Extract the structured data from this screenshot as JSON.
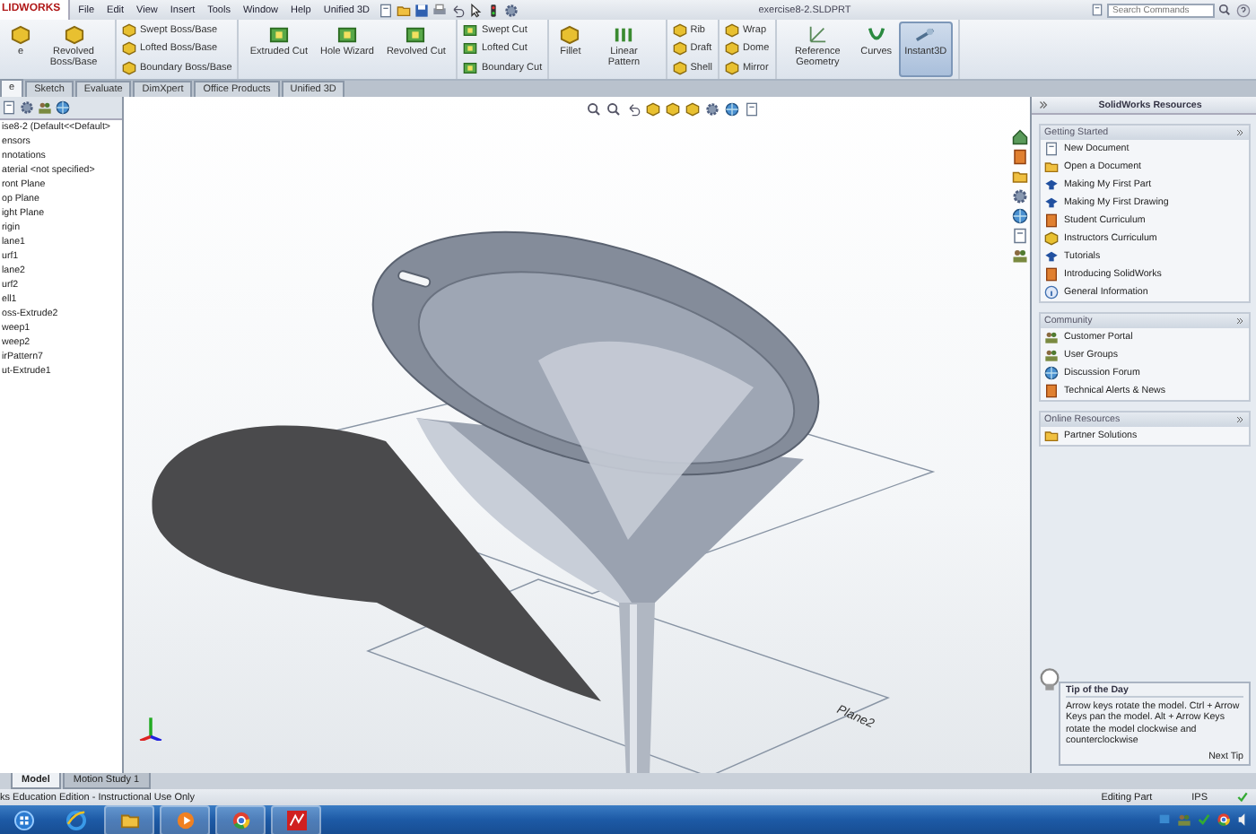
{
  "app": {
    "logo": "LIDWORKS",
    "menus": [
      "File",
      "Edit",
      "View",
      "Insert",
      "Tools",
      "Window",
      "Help",
      "Unified 3D"
    ],
    "title": "exercise8-2.SLDPRT",
    "search": {
      "placeholder": "Search Commands"
    }
  },
  "ribbon": {
    "groups": [
      {
        "kind": "large",
        "items": [
          {
            "label": "e",
            "selected": false
          },
          {
            "label": "Revolved Boss/Base",
            "selected": false
          }
        ]
      },
      {
        "kind": "stack",
        "items": [
          {
            "label": "Swept Boss/Base"
          },
          {
            "label": "Lofted Boss/Base"
          },
          {
            "label": "Boundary Boss/Base"
          }
        ]
      },
      {
        "kind": "large",
        "items": [
          {
            "label": "Extruded Cut",
            "selected": false
          },
          {
            "label": "Hole Wizard",
            "selected": false
          },
          {
            "label": "Revolved Cut",
            "selected": false
          }
        ]
      },
      {
        "kind": "stack",
        "items": [
          {
            "label": "Swept Cut"
          },
          {
            "label": "Lofted Cut"
          },
          {
            "label": "Boundary Cut"
          }
        ]
      },
      {
        "kind": "large",
        "items": [
          {
            "label": "Fillet",
            "selected": false
          },
          {
            "label": "Linear Pattern",
            "selected": false
          }
        ]
      },
      {
        "kind": "stack",
        "items": [
          {
            "label": "Rib"
          },
          {
            "label": "Draft"
          },
          {
            "label": "Shell"
          }
        ]
      },
      {
        "kind": "stack",
        "items": [
          {
            "label": "Wrap"
          },
          {
            "label": "Dome"
          },
          {
            "label": "Mirror"
          }
        ]
      },
      {
        "kind": "large",
        "items": [
          {
            "label": "Reference Geometry",
            "selected": false
          },
          {
            "label": "Curves",
            "selected": false
          },
          {
            "label": "Instant3D",
            "selected": true
          }
        ]
      }
    ],
    "tabs": [
      {
        "label": "e",
        "selected": true
      },
      {
        "label": "Sketch",
        "selected": false
      },
      {
        "label": "Evaluate",
        "selected": false
      },
      {
        "label": "DimXpert",
        "selected": false
      },
      {
        "label": "Office Products",
        "selected": false
      },
      {
        "label": "Unified 3D",
        "selected": false
      }
    ]
  },
  "tree": {
    "items": [
      "ise8-2  (Default<<Default>",
      "ensors",
      "nnotations",
      "aterial <not specified>",
      "ront Plane",
      "op Plane",
      "ight Plane",
      "rigin",
      "lane1",
      "urf1",
      "lane2",
      "urf2",
      "ell1",
      "oss-Extrude2",
      "weep1",
      "weep2",
      "irPattern7",
      "ut-Extrude1"
    ]
  },
  "viewport": {
    "plane_label": "Plane2"
  },
  "task_pane": {
    "title": "SolidWorks Resources",
    "sections": [
      {
        "title": "Getting Started",
        "items": [
          "New Document",
          "Open a Document",
          "Making My First Part",
          "Making My First Drawing",
          "Student Curriculum",
          "Instructors Curriculum",
          "Tutorials",
          "Introducing SolidWorks",
          "General Information"
        ]
      },
      {
        "title": "Community",
        "items": [
          "Customer Portal",
          "User Groups",
          "Discussion Forum",
          "Technical Alerts & News"
        ]
      },
      {
        "title": "Online Resources",
        "items": [
          "Partner Solutions"
        ]
      }
    ],
    "tip": {
      "title": "Tip of the Day",
      "text": "Arrow keys rotate the model. Ctrl + Arrow Keys pan the model. Alt + Arrow Keys rotate the model clockwise and counterclockwise",
      "next": "Next Tip"
    }
  },
  "bottom_tabs": [
    {
      "label": "Model",
      "selected": true
    },
    {
      "label": "Motion Study 1",
      "selected": false
    }
  ],
  "status": {
    "text": "ks Education Edition - Instructional Use Only",
    "mode": "Editing Part",
    "units": "IPS"
  }
}
